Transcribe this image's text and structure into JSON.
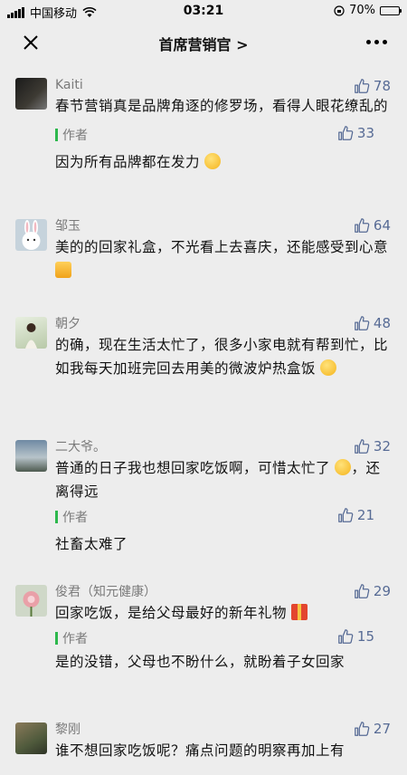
{
  "status": {
    "carrier": "中国移动",
    "time": "03:21",
    "battery": "70%"
  },
  "nav": {
    "title": "首席营销官 >"
  },
  "comments": [
    {
      "name": "Kaiti",
      "likes": "78",
      "text": "春节营销真是品牌角逐的修罗场，看得人眼花缭乱的",
      "reply": {
        "label": "作者",
        "likes": "33",
        "text": "因为所有品牌都在发力"
      }
    },
    {
      "name": "邹玉",
      "likes": "64",
      "text": "美的的回家礼盒，不光看上去喜庆，还能感受到心意"
    },
    {
      "name": "朝夕",
      "likes": "48",
      "text": "的确，现在生活太忙了，很多小家电就有帮到忙，比如我每天加班完回去用美的微波炉热盒饭"
    },
    {
      "name": "二大爷。",
      "likes": "32",
      "text": "普通的日子我也想回家吃饭啊，可惜太忙了",
      "text2": "，还离得远",
      "reply": {
        "label": "作者",
        "likes": "21",
        "text": "社畜太难了"
      }
    },
    {
      "name": "俊君（知元健康）",
      "likes": "29",
      "text": "回家吃饭，是给父母最好的新年礼物",
      "reply": {
        "label": "作者",
        "likes": "15",
        "text": "是的没错，父母也不盼什么，就盼着子女回家"
      }
    },
    {
      "name": "黎刚",
      "likes": "27",
      "text": "谁不想回家吃饭呢？痛点问题的明察再加上有"
    }
  ]
}
